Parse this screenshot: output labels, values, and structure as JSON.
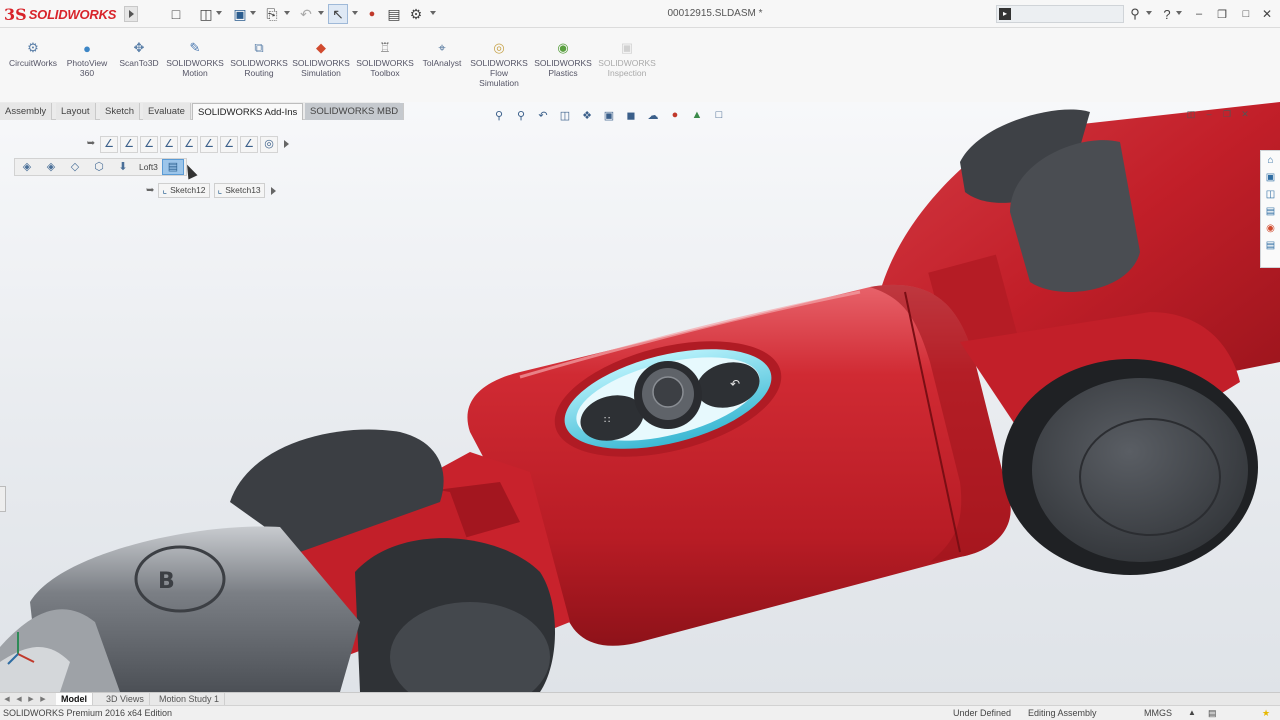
{
  "app": {
    "logo_mark": "3S",
    "logo_text": "SOLIDWORKS",
    "document_title": "00012915.SLDASM *"
  },
  "quick_access": [
    {
      "name": "new-file-icon",
      "glyph": "🗋"
    },
    {
      "name": "open-file-icon",
      "glyph": "📂"
    },
    {
      "name": "save-icon",
      "glyph": "💾"
    },
    {
      "name": "print-icon",
      "glyph": "🖶"
    },
    {
      "name": "undo-icon",
      "glyph": "↶"
    },
    {
      "name": "select-icon",
      "glyph": "⬉"
    },
    {
      "name": "rebuild-icon",
      "glyph": "●"
    },
    {
      "name": "file-properties-icon",
      "glyph": "▤"
    },
    {
      "name": "options-icon",
      "glyph": "⚙"
    }
  ],
  "search": {
    "placeholder": "",
    "value": ""
  },
  "command_manager": [
    {
      "label": "CircuitWorks",
      "icon": "circuitworks-icon",
      "glyph": "⚙",
      "color": "#5a7fa8",
      "enabled": true
    },
    {
      "label": "PhotoView\n360",
      "icon": "photoview-icon",
      "glyph": "●",
      "color": "#3d86c6",
      "enabled": true
    },
    {
      "label": "ScanTo3D",
      "icon": "scanto3d-icon",
      "glyph": "✥",
      "color": "#5a7fa8",
      "enabled": true
    },
    {
      "label": "SOLIDWORKS\nMotion",
      "icon": "motion-icon",
      "glyph": "✎",
      "color": "#4a78b0",
      "enabled": true
    },
    {
      "label": "SOLIDWORKS\nRouting",
      "icon": "routing-icon",
      "glyph": "⧉",
      "color": "#5a7fa8",
      "enabled": true
    },
    {
      "label": "SOLIDWORKS\nSimulation",
      "icon": "simulation-icon",
      "glyph": "◆",
      "color": "#d14b2f",
      "enabled": true
    },
    {
      "label": "SOLIDWORKS\nToolbox",
      "icon": "toolbox-icon",
      "glyph": "♖",
      "color": "#6b6b6b",
      "enabled": true
    },
    {
      "label": "TolAnalyst",
      "icon": "tolanalyst-icon",
      "glyph": "⌖",
      "color": "#4a6f98",
      "enabled": true
    },
    {
      "label": "SOLIDWORKS\nFlow\nSimulation",
      "icon": "flow-simulation-icon",
      "glyph": "◎",
      "color": "#c7a34a",
      "enabled": true
    },
    {
      "label": "SOLIDWORKS\nPlastics",
      "icon": "plastics-icon",
      "glyph": "◉",
      "color": "#5aa040",
      "enabled": true
    },
    {
      "label": "SOLIDWORKS\nInspection",
      "icon": "inspection-icon",
      "glyph": "▣",
      "color": "#999999",
      "enabled": false
    }
  ],
  "tabs": [
    {
      "label": "Assembly",
      "active": false
    },
    {
      "label": "Layout",
      "active": false
    },
    {
      "label": "Sketch",
      "active": false
    },
    {
      "label": "Evaluate",
      "active": false
    },
    {
      "label": "SOLIDWORKS Add-Ins",
      "active": true
    },
    {
      "label": "SOLIDWORKS MBD",
      "active": false
    }
  ],
  "context_toolbar": {
    "feature_label": "Loft3",
    "sketches": [
      "Sketch12",
      "Sketch13"
    ]
  },
  "bottom_tabs": [
    {
      "label": "Model",
      "active": true
    },
    {
      "label": "3D Views",
      "active": false
    },
    {
      "label": "Motion Study 1",
      "active": false
    }
  ],
  "status_bar": {
    "edition": "SOLIDWORKS Premium 2016 x64 Edition",
    "definition_state": "Under Defined",
    "edit_mode": "Editing Assembly",
    "units": "MMGS"
  },
  "colors": {
    "brand_red": "#d8232a",
    "model_red": "#c8222c",
    "model_gray": "#5c6066",
    "button_cyan": "#5fd3ea"
  }
}
